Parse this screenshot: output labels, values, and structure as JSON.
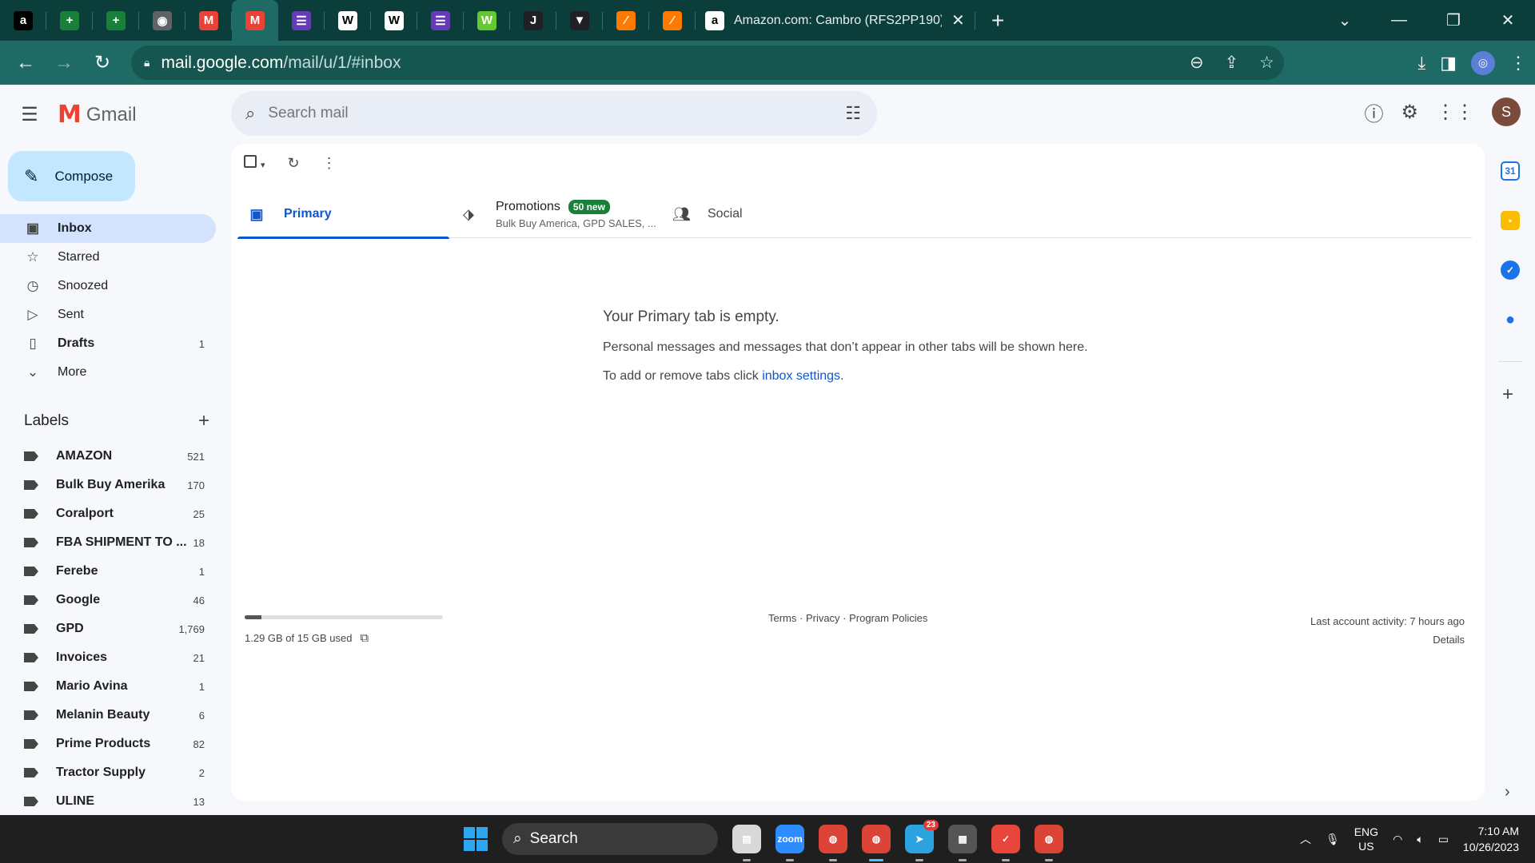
{
  "browser": {
    "pinned_tabs": [
      {
        "icon": "amazon-icon",
        "glyph": "a",
        "color": "#000000"
      },
      {
        "icon": "sheets-icon",
        "glyph": "+",
        "color": "#188038"
      },
      {
        "icon": "sheets-icon",
        "glyph": "+",
        "color": "#188038"
      },
      {
        "icon": "globe-icon",
        "glyph": "◉",
        "color": "#5f6368"
      },
      {
        "icon": "gmail-icon",
        "glyph": "M",
        "color": "#ea4335"
      },
      {
        "icon": "gmail-icon",
        "glyph": "M",
        "color": "#ea4335"
      },
      {
        "icon": "list-icon",
        "glyph": "☰",
        "color": "#673ab7"
      },
      {
        "icon": "chart-doc-icon",
        "glyph": "W",
        "color": "#ffffff"
      },
      {
        "icon": "chart-doc-icon",
        "glyph": "W",
        "color": "#ffffff"
      },
      {
        "icon": "list-icon",
        "glyph": "☰",
        "color": "#673ab7"
      },
      {
        "icon": "w-app-icon",
        "glyph": "W",
        "color": "#64c832"
      },
      {
        "icon": "j-app-icon",
        "glyph": "J",
        "color": "#202124"
      },
      {
        "icon": "logo-app-icon",
        "glyph": "▼",
        "color": "#202124"
      },
      {
        "icon": "slash-app-icon",
        "glyph": "⁄",
        "color": "#ff7a00"
      },
      {
        "icon": "slash-app-icon",
        "glyph": "⁄",
        "color": "#ff7a00"
      }
    ],
    "active_tab_title": "Amazon.com: Cambro (RFS2PP190)",
    "url_host": "mail.google.com",
    "url_path": "/mail/u/1/#inbox"
  },
  "gmail": {
    "app_name": "Gmail",
    "search_placeholder": "Search mail",
    "avatar_initial": "S",
    "compose_label": "Compose",
    "nav": [
      {
        "label": "Inbox",
        "icon": "inbox-icon",
        "glyph": "▣",
        "count": "",
        "active": true,
        "bold": true
      },
      {
        "label": "Starred",
        "icon": "star-icon",
        "glyph": "☆",
        "count": "",
        "active": false,
        "bold": false
      },
      {
        "label": "Snoozed",
        "icon": "clock-icon",
        "glyph": "◷",
        "count": "",
        "active": false,
        "bold": false
      },
      {
        "label": "Sent",
        "icon": "send-icon",
        "glyph": "▷",
        "count": "",
        "active": false,
        "bold": false
      },
      {
        "label": "Drafts",
        "icon": "draft-icon",
        "glyph": "▯",
        "count": "1",
        "active": false,
        "bold": true
      },
      {
        "label": "More",
        "icon": "chevron-down-icon",
        "glyph": "⌄",
        "count": "",
        "active": false,
        "bold": false
      }
    ],
    "labels_title": "Labels",
    "labels": [
      {
        "label": "AMAZON",
        "count": "521"
      },
      {
        "label": "Bulk Buy Amerika",
        "count": "170"
      },
      {
        "label": "Coralport",
        "count": "25"
      },
      {
        "label": "FBA SHIPMENT TO ...",
        "count": "18"
      },
      {
        "label": "Ferebe",
        "count": "1"
      },
      {
        "label": "Google",
        "count": "46"
      },
      {
        "label": "GPD",
        "count": "1,769"
      },
      {
        "label": "Invoices",
        "count": "21"
      },
      {
        "label": "Mario Avina",
        "count": "1"
      },
      {
        "label": "Melanin Beauty",
        "count": "6"
      },
      {
        "label": "Prime Products",
        "count": "82"
      },
      {
        "label": "Tractor Supply",
        "count": "2"
      },
      {
        "label": "ULINE",
        "count": "13"
      }
    ],
    "tabs": {
      "primary": "Primary",
      "promotions": "Promotions",
      "promotions_badge": "50 new",
      "promotions_sub": "Bulk Buy America, GPD SALES, ...",
      "social": "Social"
    },
    "empty": {
      "title": "Your Primary tab is empty.",
      "line1": "Personal messages and messages that don’t appear in other tabs will be shown here.",
      "line2_prefix": "To add or remove tabs click ",
      "line2_link": "inbox settings",
      "line2_suffix": "."
    },
    "footer": {
      "storage_text": "1.29 GB of 15 GB used",
      "storage_fraction": 0.086,
      "links": "Terms · Privacy · Program Policies",
      "last_activity": "Last account activity: 7 hours ago",
      "details": "Details"
    }
  },
  "taskbar": {
    "search_label": "Search",
    "apps": [
      {
        "icon": "file-explorer-icon",
        "glyph": "▤",
        "color": "#d8d8d8",
        "active": false,
        "badge": ""
      },
      {
        "icon": "zoom-icon",
        "glyph": "zoom",
        "color": "#2d8cff",
        "active": false,
        "badge": ""
      },
      {
        "icon": "chrome-icon",
        "glyph": "◍",
        "color": "#db4437",
        "active": false,
        "badge": ""
      },
      {
        "icon": "chrome-icon",
        "glyph": "◍",
        "color": "#db4437",
        "active": true,
        "badge": ""
      },
      {
        "icon": "telegram-icon",
        "glyph": "➤",
        "color": "#2aa3df",
        "active": false,
        "badge": "23"
      },
      {
        "icon": "calculator-icon",
        "glyph": "▦",
        "color": "#555555",
        "active": false,
        "badge": ""
      },
      {
        "icon": "tick-app-icon",
        "glyph": "✓",
        "color": "#e8453c",
        "active": false,
        "badge": ""
      },
      {
        "icon": "chrome-icon",
        "glyph": "◍",
        "color": "#db4437",
        "active": false,
        "badge": ""
      }
    ],
    "lang_line1": "ENG",
    "lang_line2": "US",
    "time": "7:10 AM",
    "date": "10/26/2023"
  }
}
